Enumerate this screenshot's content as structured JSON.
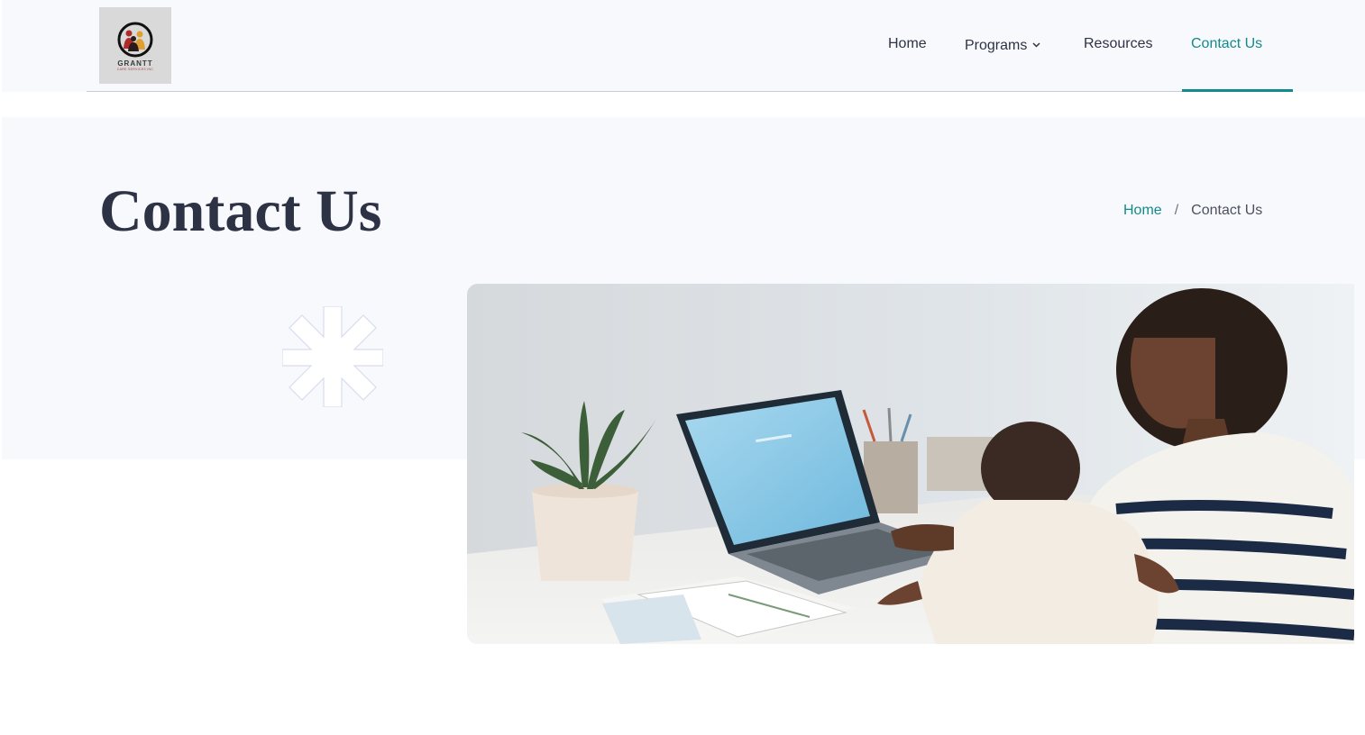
{
  "brand": {
    "logo_text": "GRANTT",
    "logo_subtext": "CARE SERVICES INC"
  },
  "nav": {
    "items": [
      {
        "label": "Home",
        "active": false
      },
      {
        "label": "Programs",
        "active": false,
        "has_dropdown": true
      },
      {
        "label": "Resources",
        "active": false
      },
      {
        "label": "Contact Us",
        "active": true
      }
    ]
  },
  "page": {
    "title": "Contact Us"
  },
  "breadcrumb": {
    "home": "Home",
    "separator": "/",
    "current": "Contact Us"
  },
  "colors": {
    "accent": "#138a8c",
    "text_dark": "#2d3345",
    "banner_bg": "#f8f9fc"
  },
  "icons": {
    "dropdown": "chevron-down-icon",
    "decoration": "asterisk-icon"
  }
}
